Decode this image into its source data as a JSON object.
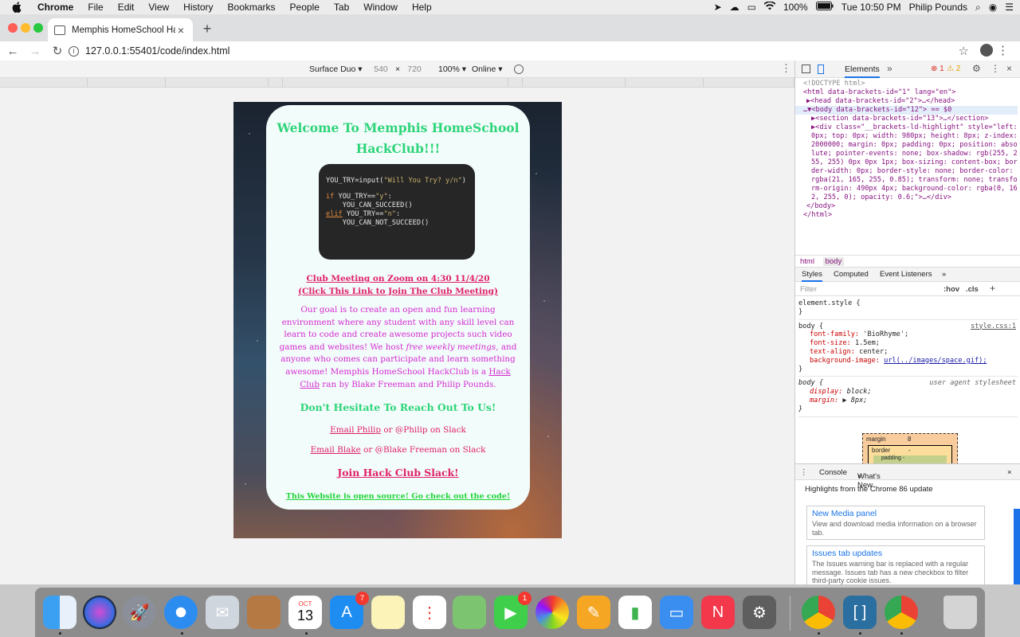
{
  "menubar": {
    "items": [
      "Chrome",
      "File",
      "Edit",
      "View",
      "History",
      "Bookmarks",
      "People",
      "Tab",
      "Window",
      "Help"
    ],
    "battery": "100%",
    "clock": "Tue 10:50 PM",
    "user": "Philip Pounds"
  },
  "browser": {
    "tab_title": "Memphis HomeSchool HackClub",
    "url": "127.0.0.1:55401/code/index.html"
  },
  "device_toolbar": {
    "device": "Surface Duo",
    "width": "540",
    "times": "×",
    "height": "720",
    "zoom": "100%",
    "network": "Online"
  },
  "page": {
    "welcome": "Welcome To Memphis HomeSchool HackClub!!!",
    "code": {
      "line1_a": "YOU_TRY=input(",
      "line1_str": "\"Will You Try? y/n\"",
      "line1_b": ")",
      "line2_kw": "if",
      "line2_a": " YOU_TRY==",
      "line2_str": "\"y\"",
      "line2_b": ":",
      "line3": "    YOU_CAN_SUCCEED()",
      "line4_kw": "elif",
      "line4_a": " YOU_TRY==",
      "line4_str": "\"n\"",
      "line4_b": ":",
      "line5": "    YOU_CAN_NOT_SUCCEED()"
    },
    "meeting": "Club Meeting on Zoom on 4:30 11/4/20",
    "meeting_link": "(Click This Link to Join The Club Meeting)",
    "about_1": "Our goal is to create an open and fun learning environment where any student with any skill level can learn to code and create awesome projects such video games and websites! We host ",
    "about_em": "free weekly meetings",
    "about_2": ", and anyone who comes can participate and learn something awesome! Memphis HomeSchool HackClub is a ",
    "about_link": "Hack Club",
    "about_3": " ran by Blake Freeman and Philip Pounds.",
    "hesitate": "Don't Hesitate To Reach Out To Us!",
    "email_philip": "Email Philip",
    "philip_slack": " or @Philip on Slack",
    "email_blake": "Email Blake",
    "blake_slack": " or @Blake Freeman on Slack",
    "join_slack": "Join Hack Club Slack!",
    "open_source": "This Website is open source! Go check out the code!"
  },
  "devtools": {
    "tab_elements": "Elements",
    "errors": "1",
    "warnings": "2",
    "dom": {
      "doctype": "<!DOCTYPE html>",
      "html_open": "<html data-brackets-id=\"1\" lang=\"en\">",
      "head": "▶<head data-brackets-id=\"2\">…</head>",
      "body": "…▼<body data-brackets-id=\"12\"> == $0",
      "section": "▶<section data-brackets-id=\"13\">…</section>",
      "div": "▶<div class=\"__brackets-ld-highlight\" style=\"left: 0px; top: 0px; width: 980px; height: 8px; z-index: 2000000; margin: 0px; padding: 0px; position: absolute; pointer-events: none; box-shadow: rgb(255, 255, 255) 0px 0px 1px; box-sizing: content-box; border-width: 0px; border-style: none; border-color: rgba(21, 165, 255, 0.85); transform: none; transform-origin: 490px 4px; background-color: rgba(0, 162, 255, 0); opacity: 0.6;\">…</div>",
      "body_close": "</body>",
      "html_close": "</html>"
    },
    "crumbs": [
      "html",
      "body"
    ],
    "subtabs": [
      "Styles",
      "Computed",
      "Event Listeners"
    ],
    "filter_placeholder": "Filter",
    "hov": ":hov",
    "cls": ".cls",
    "element_style": "element.style {",
    "close_brace": "}",
    "body_rule": "body {",
    "body_src": "style.css:1",
    "props": [
      {
        "name": "font-family",
        "value": "'BioRhyme';"
      },
      {
        "name": "font-size",
        "value": "1.5em;"
      },
      {
        "name": "text-align",
        "value": "center;"
      },
      {
        "name": "background-image",
        "value": "url(../images/space.gif);"
      }
    ],
    "ua_rule": "body {",
    "ua_label": "user agent stylesheet",
    "ua_props": [
      {
        "name": "display",
        "value": "block;"
      },
      {
        "name": "margin",
        "value": "▶ 8px;"
      }
    ],
    "box": {
      "margin": "margin",
      "margin_val": "8",
      "border": "border",
      "border_val": "-",
      "padding": "padding -"
    },
    "drawer_tabs": [
      "Console",
      "What's New"
    ],
    "headline": "Highlights from the Chrome 86 update",
    "news": [
      {
        "title": "New Media panel",
        "desc": "View and download media information on a browser tab."
      },
      {
        "title": "Issues tab updates",
        "desc": "The Issues warning bar is replaced with a regular message. Issues tab has a new checkbox to filter third-party cookie issues."
      }
    ]
  },
  "dock": {
    "calendar_month": "OCT",
    "calendar_day": "13",
    "appstore_badge": "7",
    "facetime_badge": "1"
  }
}
